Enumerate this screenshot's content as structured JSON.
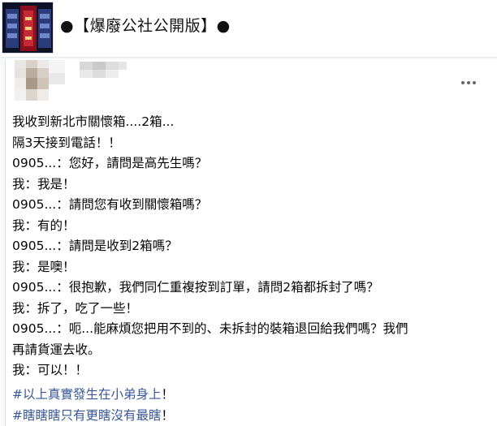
{
  "group": {
    "title": "●【爆廢公社公開版】●"
  },
  "post": {
    "menu_icon": "more-horizontal-icon",
    "lines": [
      "我收到新北市關懷箱....2箱...",
      "隔3天接到電話！！",
      "0905...：您好，請問是高先生嗎？",
      "我：我是！",
      "0905...：請問您有收到關懷箱嗎？",
      "我：有的！",
      "0905...：請問是收到2箱嗎？",
      "我：是噢！",
      "0905...：很抱歉，我們同仁重複按到訂單，請問2箱都拆封了嗎？",
      "我：拆了，吃了一些！",
      "0905...：呃...能麻煩您把用不到的、未拆封的裝箱退回給我們嗎？我們",
      "再請貨運去收。",
      "我：可以！！"
    ],
    "hashtags": [
      {
        "tag": "#以上真實發生在小弟身上",
        "suffix": "！"
      },
      {
        "tag": "#瞎瞎瞎只有更瞎沒有最瞎",
        "suffix": "！"
      }
    ]
  }
}
